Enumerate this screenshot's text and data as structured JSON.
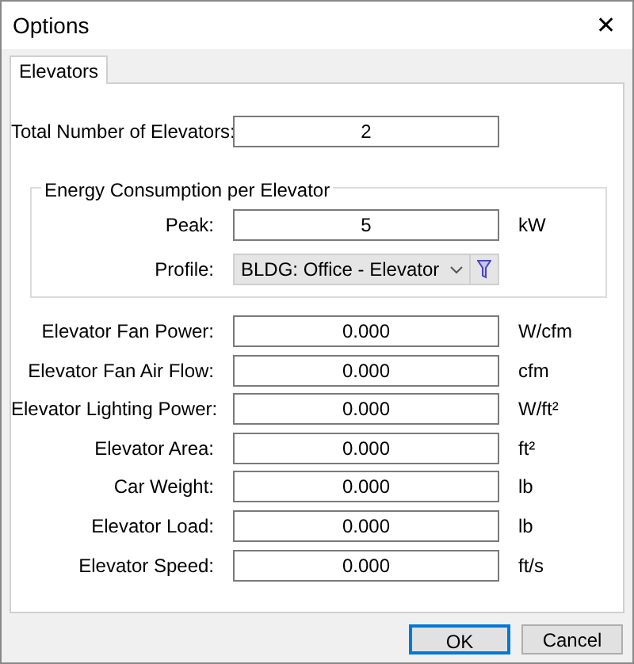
{
  "window": {
    "title": "Options",
    "close": "✕"
  },
  "tabs": [
    {
      "label": "Elevators",
      "selected": true
    }
  ],
  "total": {
    "label": "Total Number of Elevators:",
    "value": "2"
  },
  "group": {
    "title": "Energy Consumption per Elevator",
    "peak": {
      "label": "Peak:",
      "value": "5",
      "unit": "kW"
    },
    "profile": {
      "label": "Profile:",
      "value": "BLDG: Office - Elevator"
    }
  },
  "fields": [
    {
      "label": "Elevator Fan Power:",
      "value": "0.000",
      "unit": "W/cfm"
    },
    {
      "label": "Elevator Fan Air Flow:",
      "value": "0.000",
      "unit": "cfm"
    },
    {
      "label": "Elevator Lighting Power:",
      "value": "0.000",
      "unit": "W/ft²"
    },
    {
      "label": "Elevator Area:",
      "value": "0.000",
      "unit": "ft²"
    },
    {
      "label": "Car Weight:",
      "value": "0.000",
      "unit": "lb"
    },
    {
      "label": "Elevator Load:",
      "value": "0.000",
      "unit": "lb"
    },
    {
      "label": "Elevator Speed:",
      "value": "0.000",
      "unit": "ft/s"
    }
  ],
  "buttons": [
    {
      "label": "OK",
      "kind": "default"
    },
    {
      "label": "Cancel",
      "kind": "normal"
    }
  ]
}
